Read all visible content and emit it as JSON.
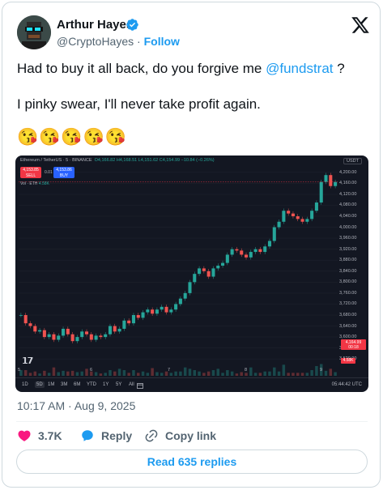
{
  "author": {
    "name": "Arthur Hayes",
    "handle": "@CryptoHayes",
    "separator": "·",
    "follow_label": "Follow",
    "verified": true
  },
  "post": {
    "line1_text": "Had to buy it all back, do you forgive me ",
    "line1_mention": "@fundstrat",
    "line1_suffix": " ?",
    "line2_text": "I pinky swear, I'll never take profit again.",
    "emojis": "😘😘😘😘😘"
  },
  "chart_image": {
    "symbol_line": "Ethereum / TetherUS · 5 · BINANCE",
    "ohlc": "O4,166.82 H4,168.51 L4,151.62 C4,154.99 −10.84 (−0.26%)",
    "currency": "USDT",
    "sell_price": "4,153.85",
    "sell_label": "SELL",
    "spread": "0.01",
    "buy_price": "4,153.86",
    "buy_label": "BUY",
    "volume_label": "Vol · ETH",
    "volume_value": "4.58K",
    "last_price": "4,164.99",
    "last_timer": "00:18",
    "vol_tag": "4.58K",
    "logo": "𝟭𝟳",
    "timeframes": [
      "1D",
      "5D",
      "1M",
      "3M",
      "6M",
      "YTD",
      "1Y",
      "5Y",
      "All"
    ],
    "active_timeframe": "5D",
    "clock": "05:44:42 UTC",
    "chart_data": {
      "type": "line",
      "title": "Ethereum / TetherUS · 5 · BINANCE",
      "xlabel": "",
      "ylabel": "",
      "x_ticks": [
        "5",
        "6",
        "7",
        "8",
        "9"
      ],
      "y_ticks": [
        "4,200.00",
        "4,160.00",
        "4,120.00",
        "4,080.00",
        "4,040.00",
        "4,000.00",
        "3,960.00",
        "3,920.00",
        "3,880.00",
        "3,840.00",
        "3,800.00",
        "3,760.00",
        "3,720.00",
        "3,680.00",
        "3,640.00",
        "3,600.00",
        "3,560.00",
        "3,520.00"
      ],
      "ylim": [
        3500,
        4220
      ],
      "series": [
        {
          "values": [
            3680,
            3650,
            3640,
            3620,
            3625,
            3600,
            3610,
            3590,
            3605,
            3630,
            3610,
            3585,
            3600,
            3620,
            3610,
            3590,
            3605,
            3600,
            3610,
            3640,
            3620,
            3630,
            3660,
            3650,
            3680,
            3670,
            3690,
            3700,
            3685,
            3700,
            3710,
            3690,
            3700,
            3720,
            3740,
            3760,
            3800,
            3830,
            3850,
            3840,
            3820,
            3850,
            3860,
            3870,
            3900,
            3920,
            3915,
            3900,
            3890,
            3910,
            3920,
            3910,
            3930,
            3950,
            4000,
            4020,
            4060,
            4050,
            4040,
            4030,
            4020,
            4030,
            4060,
            4090,
            4165,
            4190,
            4150,
            4165
          ]
        }
      ],
      "grid": true
    }
  },
  "meta": {
    "time": "10:17 AM",
    "separator": "·",
    "date": "Aug 9, 2025"
  },
  "actions": {
    "likes": "3.7K",
    "reply_label": "Reply",
    "copy_link_label": "Copy link",
    "read_replies_label": "Read 635 replies"
  },
  "colors": {
    "accent": "#1d9bf0",
    "like": "#f91880",
    "chart_bg": "#131722",
    "up": "#26a69a",
    "down": "#ef5350"
  }
}
